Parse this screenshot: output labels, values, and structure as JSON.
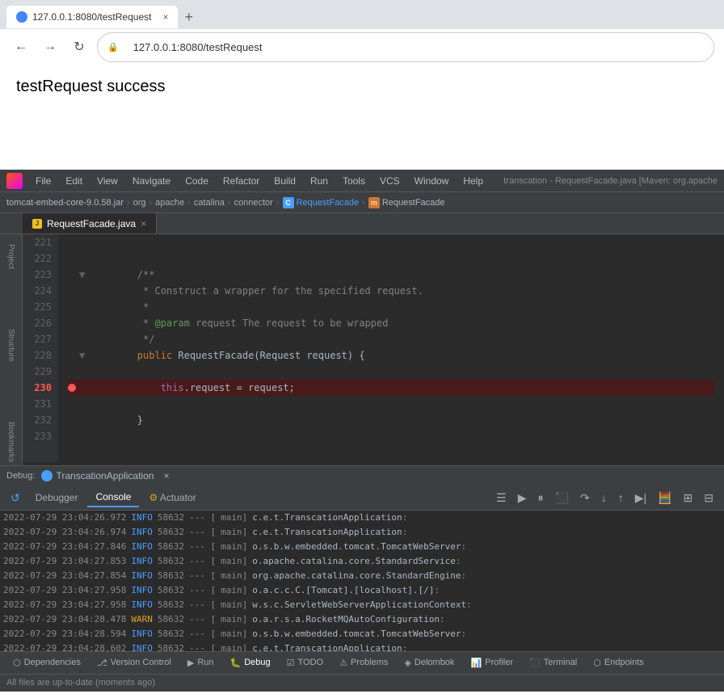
{
  "browser": {
    "tab_favicon": "●",
    "tab_title": "127.0.0.1:8080/testRequest",
    "tab_close": "×",
    "new_tab": "+",
    "nav_back": "←",
    "nav_forward": "→",
    "nav_refresh": "↻",
    "address_lock": "🔒",
    "address_url": "127.0.0.1:8080/testRequest",
    "page_content": "testRequest success"
  },
  "ide": {
    "menu_items": [
      "File",
      "Edit",
      "View",
      "Navigate",
      "Code",
      "Refactor",
      "Build",
      "Run",
      "Tools",
      "VCS",
      "Window",
      "Help"
    ],
    "title": "transcation - RequestFacade.java [Maven: org.apache",
    "breadcrumb": {
      "jar": "tomcat-embed-core-9.0.58.jar",
      "parts": [
        "org",
        "apache",
        "catalina",
        "connector"
      ],
      "file": "RequestFacade",
      "member": "RequestFacade"
    },
    "tab_name": "RequestFacade.java",
    "code_lines": [
      {
        "num": "221",
        "indent": "",
        "content": "",
        "type": "empty"
      },
      {
        "num": "222",
        "indent": "",
        "content": "",
        "type": "empty"
      },
      {
        "num": "223",
        "indent": "        ",
        "content": "/**",
        "type": "comment"
      },
      {
        "num": "224",
        "indent": "        ",
        "content": " * Construct a wrapper for the specified request.",
        "type": "comment"
      },
      {
        "num": "225",
        "indent": "        ",
        "content": " *",
        "type": "comment"
      },
      {
        "num": "226",
        "indent": "        ",
        "content": " * @param request The request to be wrapped",
        "type": "comment-param"
      },
      {
        "num": "227",
        "indent": "        ",
        "content": "         */",
        "type": "comment"
      },
      {
        "num": "228",
        "indent": "        ",
        "content": "public RequestFacade(Request request) {",
        "type": "code"
      },
      {
        "num": "229",
        "indent": "",
        "content": "",
        "type": "empty"
      },
      {
        "num": "230",
        "indent": "            ",
        "content": "this.request = request;",
        "type": "code-breakpoint"
      },
      {
        "num": "231",
        "indent": "",
        "content": "",
        "type": "empty"
      },
      {
        "num": "232",
        "indent": "        ",
        "content": "}",
        "type": "code"
      },
      {
        "num": "233",
        "indent": "",
        "content": "",
        "type": "empty"
      }
    ],
    "debug": {
      "label": "Debug:",
      "app_name": "TranscationApplication",
      "tabs": [
        "Debugger",
        "Console",
        "Actuator"
      ],
      "active_tab": "Console",
      "toolbar_btns": [
        "▶",
        "↓",
        "↑",
        "↓",
        "↕",
        "↑",
        "⬛",
        "⬜",
        "⬜"
      ],
      "log_entries": [
        {
          "timestamp": "2022-07-29 23:04:26.972",
          "level": "INFO",
          "pid": "58632",
          "sep": "---",
          "bracket": "[",
          "thread": "           main]",
          "class": "c.e.t.TranscationApplication",
          "suffix": " :"
        },
        {
          "timestamp": "2022-07-29 23:04:26.974",
          "level": "INFO",
          "pid": "58632",
          "sep": "---",
          "bracket": "[",
          "thread": "           main]",
          "class": "c.e.t.TranscationApplication",
          "suffix": " :"
        },
        {
          "timestamp": "2022-07-29 23:04:27.846",
          "level": "INFO",
          "pid": "58632",
          "sep": "---",
          "bracket": "[",
          "thread": "           main]",
          "class": "o.s.b.w.embedded.tomcat.TomcatWebServer",
          "suffix": " :"
        },
        {
          "timestamp": "2022-07-29 23:04:27.853",
          "level": "INFO",
          "pid": "58632",
          "sep": "---",
          "bracket": "[",
          "thread": "           main]",
          "class": "o.apache.catalina.core.StandardService",
          "suffix": " :"
        },
        {
          "timestamp": "2022-07-29 23:04:27.854",
          "level": "INFO",
          "pid": "58632",
          "sep": "---",
          "bracket": "[",
          "thread": "           main]",
          "class": "org.apache.catalina.core.StandardEngine",
          "suffix": " :"
        },
        {
          "timestamp": "2022-07-29 23:04:27.958",
          "level": "INFO",
          "pid": "58632",
          "sep": "---",
          "bracket": "[",
          "thread": "           main]",
          "class": "o.a.c.c.C.[Tomcat].[localhost].[/]",
          "suffix": " :"
        },
        {
          "timestamp": "2022-07-29 23:04:27.958",
          "level": "INFO",
          "pid": "58632",
          "sep": "---",
          "bracket": "[",
          "thread": "           main]",
          "class": "w.s.c.ServletWebServerApplicationContext",
          "suffix": " :"
        },
        {
          "timestamp": "2022-07-29 23:04:28.478",
          "level": "WARN",
          "pid": "58632",
          "sep": "---",
          "bracket": "[",
          "thread": "           main]",
          "class": "o.a.r.s.a.RocketMQAutoConfiguration",
          "suffix": " :"
        },
        {
          "timestamp": "2022-07-29 23:04:28.594",
          "level": "INFO",
          "pid": "58632",
          "sep": "---",
          "bracket": "[",
          "thread": "           main]",
          "class": "o.s.b.w.embedded.tomcat.TomcatWebServer",
          "suffix": " :"
        },
        {
          "timestamp": "2022-07-29 23:04:28.602",
          "level": "INFO",
          "pid": "58632",
          "sep": "---",
          "bracket": "[",
          "thread": "           main]",
          "class": "c.e.t.TranscationApplication",
          "suffix": " :"
        }
      ]
    },
    "bottom_tabs": [
      "Dependencies",
      "Version Control",
      "Run",
      "Debug",
      "TODO",
      "Problems",
      "Delombok",
      "Profiler",
      "Terminal",
      "Endpoints"
    ],
    "active_bottom_tab": "Debug",
    "status": "All files are up-to-date (moments ago)"
  }
}
